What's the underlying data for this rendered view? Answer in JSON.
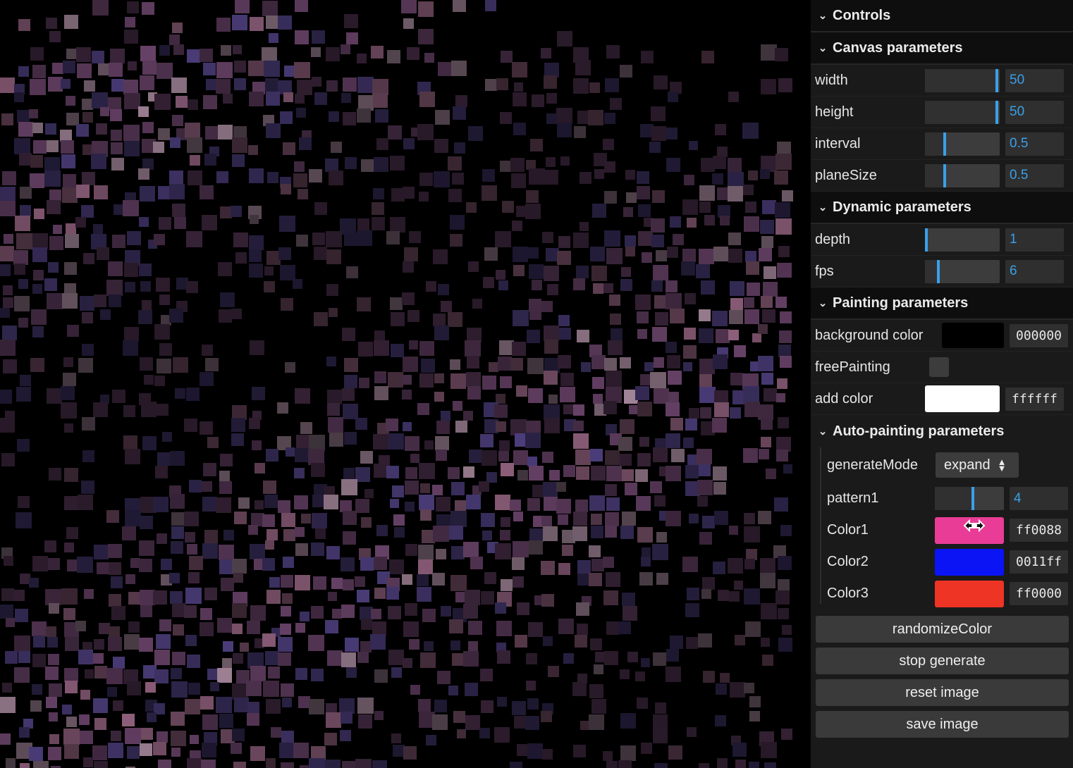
{
  "panel": {
    "title": "Controls",
    "canvas_folder": {
      "title": "Canvas parameters",
      "width": {
        "label": "width",
        "value": "50",
        "fraction": 0.98
      },
      "height": {
        "label": "height",
        "value": "50",
        "fraction": 0.98
      },
      "interval": {
        "label": "interval",
        "value": "0.5",
        "fraction": 0.25
      },
      "planeSize": {
        "label": "planeSize",
        "value": "0.5",
        "fraction": 0.25
      }
    },
    "dynamic_folder": {
      "title": "Dynamic parameters",
      "depth": {
        "label": "depth",
        "value": "1",
        "fraction": 0.0
      },
      "fps": {
        "label": "fps",
        "value": "6",
        "fraction": 0.17
      }
    },
    "painting_folder": {
      "title": "Painting parameters",
      "background_color": {
        "label": "background color",
        "value": "000000",
        "color": "#000000"
      },
      "free_painting": {
        "label": "freePainting",
        "checked": false
      },
      "add_color": {
        "label": "add color",
        "value": "ffffff",
        "color": "#ffffff"
      }
    },
    "auto_folder": {
      "title": "Auto-painting parameters",
      "generate_mode": {
        "label": "generateMode",
        "value": "expand"
      },
      "pattern1": {
        "label": "pattern1",
        "value": "4",
        "fraction": 0.55
      },
      "color1": {
        "label": "Color1",
        "value": "ff0088",
        "color": "#e83c96"
      },
      "color2": {
        "label": "Color2",
        "value": "0011ff",
        "color": "#0a14f5"
      },
      "color3": {
        "label": "Color3",
        "value": "ff0000",
        "color": "#ee3424"
      }
    },
    "buttons": {
      "randomize": "randomizeColor",
      "stop": "stop generate",
      "reset": "reset image",
      "save": "save image"
    }
  },
  "icons": {
    "chevron": "chevron-down-icon",
    "cursor": "resize-horizontal-cursor-icon",
    "select_arrows": "select-arrows-icon"
  }
}
